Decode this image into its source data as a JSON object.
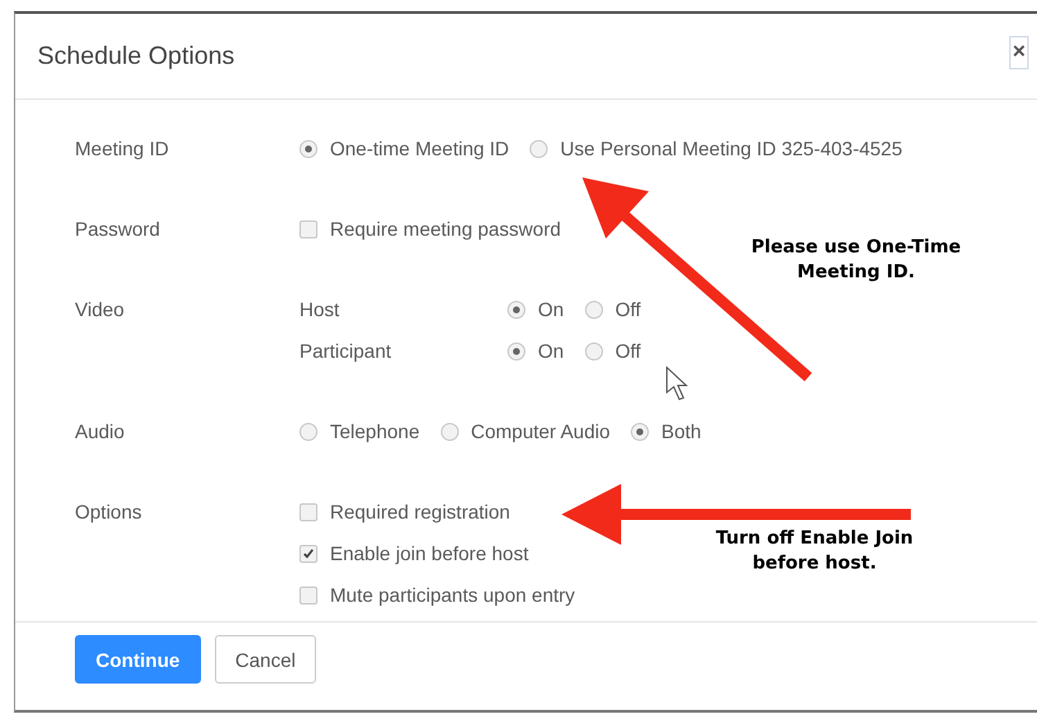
{
  "dialog": {
    "title": "Schedule Options",
    "close": "×"
  },
  "sections": [
    {
      "label": "Meeting ID",
      "rows": [
        {
          "kind": "radio",
          "options": [
            {
              "label": "One-time Meeting ID",
              "selected": true
            },
            {
              "label": "Use Personal Meeting ID 325-403-4525",
              "selected": false
            }
          ]
        }
      ]
    },
    {
      "label": "Password",
      "rows": [
        {
          "kind": "checkbox",
          "label": "Require meeting password",
          "checked": false
        }
      ]
    },
    {
      "label": "Video",
      "rows": [
        {
          "kind": "radio",
          "sublabel": "Host",
          "options": [
            {
              "label": "On",
              "selected": true
            },
            {
              "label": "Off",
              "selected": false
            }
          ]
        },
        {
          "kind": "radio",
          "sublabel": "Participant",
          "options": [
            {
              "label": "On",
              "selected": true
            },
            {
              "label": "Off",
              "selected": false
            }
          ]
        }
      ]
    },
    {
      "label": "Audio",
      "rows": [
        {
          "kind": "radio",
          "options": [
            {
              "label": "Telephone",
              "selected": false
            },
            {
              "label": "Computer Audio",
              "selected": false
            },
            {
              "label": "Both",
              "selected": true
            }
          ]
        }
      ]
    },
    {
      "label": "Options",
      "rows": [
        {
          "kind": "checkbox",
          "label": "Required registration",
          "checked": false
        },
        {
          "kind": "checkbox",
          "label": "Enable join before host",
          "checked": true
        },
        {
          "kind": "checkbox",
          "label": "Mute participants upon entry",
          "checked": false
        }
      ]
    }
  ],
  "buttons": [
    {
      "label": "Continue",
      "kind": "primary"
    },
    {
      "label": "Cancel",
      "kind": "secondary"
    }
  ],
  "annotations": [
    {
      "text": "Please use One-Time Meeting ID."
    },
    {
      "text": "Turn off Enable Join before host."
    }
  ]
}
